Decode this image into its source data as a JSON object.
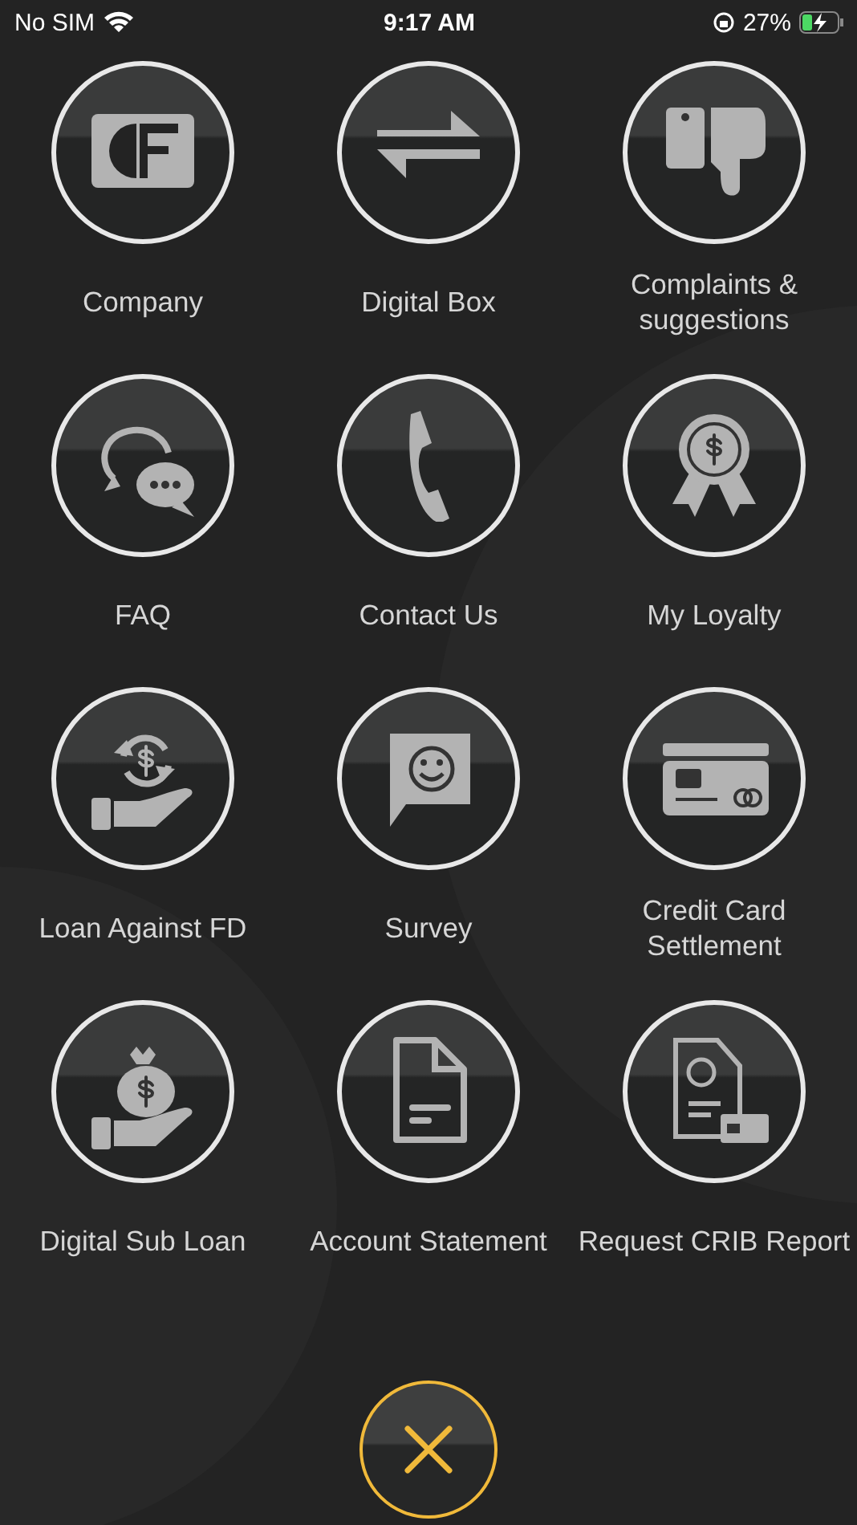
{
  "status_bar": {
    "carrier": "No SIM",
    "time": "9:17 AM",
    "battery": "27%"
  },
  "tiles": [
    {
      "kind": "logo",
      "label": "Company"
    },
    {
      "kind": "transfer",
      "label": "Digital Box"
    },
    {
      "kind": "thumbs",
      "label": "Complaints & suggestions"
    },
    {
      "kind": "chat",
      "label": "FAQ"
    },
    {
      "kind": "phone",
      "label": "Contact Us"
    },
    {
      "kind": "award",
      "label": "My Loyalty"
    },
    {
      "kind": "loan",
      "label": "Loan Against FD"
    },
    {
      "kind": "survey",
      "label": "Survey"
    },
    {
      "kind": "card",
      "label": "Credit Card Settlement"
    },
    {
      "kind": "bag",
      "label": "Digital Sub Loan"
    },
    {
      "kind": "document",
      "label": "Account Statement"
    },
    {
      "kind": "report",
      "label": "Request CRIB Report"
    }
  ]
}
